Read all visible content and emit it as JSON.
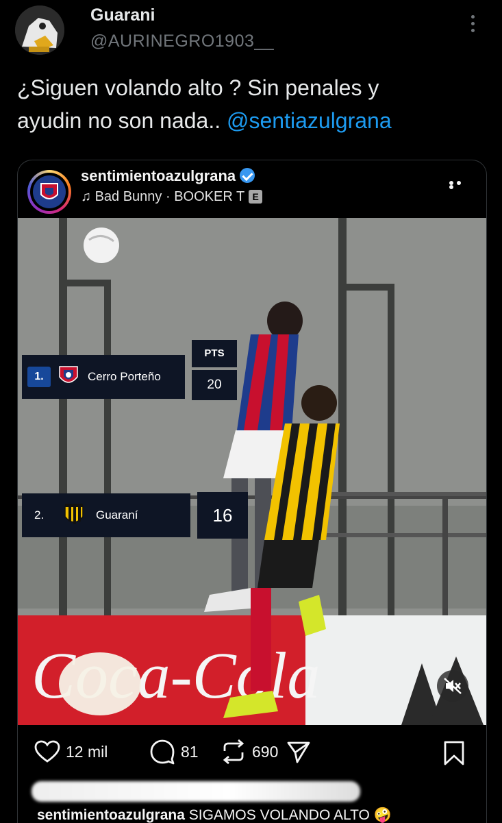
{
  "tweet": {
    "display_name": "Guarani",
    "handle": "@AURINEGRO1903__",
    "text_line1": "¿Siguen volando alto ? Sin penales y",
    "text_line2": "ayudin no son nada.. ",
    "mention": "@sentiazulgrana"
  },
  "embed": {
    "username": "sentimientoazulgrana",
    "audio_icon": "music-note-icon",
    "audio": "Bad Bunny · BOOKER T",
    "explicit": "E",
    "overlay": {
      "pts_header": "PTS",
      "rows": [
        {
          "rank": "1.",
          "team": "Cerro Porteño",
          "points": "20"
        },
        {
          "rank": "2.",
          "team": "Guaraní",
          "points": "16"
        }
      ],
      "banner_text": "Coca-Cola"
    },
    "actions": {
      "likes": "12 mil",
      "comments": "81",
      "reposts": "690"
    },
    "caption_user": "sentimientoazulgrana",
    "caption_text": "SIGAMOS VOLANDO ALTO",
    "caption_emoji": "🤪"
  },
  "colors": {
    "mention": "#1d9bf0",
    "table_bg": "#0e1525",
    "rank_badge": "#17489a",
    "cerro_red": "#c8102e",
    "cerro_blue": "#1e3c8c",
    "guarani_yellow": "#f2c200"
  }
}
